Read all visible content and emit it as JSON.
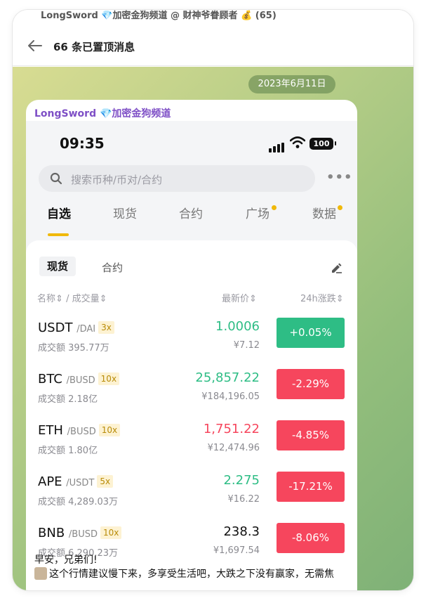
{
  "telegram": {
    "top_strip": "LongSword 💎加密金狗频道 @ 财神爷眷顾者 💰 (65)",
    "header_title": "66 条已置顶消息",
    "date_pill": "2023年6月11日",
    "sender": "LongSword 💎加密金狗频道",
    "message_line1": "早安，兄弟们!",
    "message_line2": "这个行情建议慢下来，多享受生活吧，大跌之下没有赢家，无需焦"
  },
  "phone": {
    "time": "09:35",
    "battery": "100"
  },
  "search": {
    "placeholder": "搜索币种/币对/合约"
  },
  "main_tabs": [
    {
      "label": "自选"
    },
    {
      "label": "现货"
    },
    {
      "label": "合约"
    },
    {
      "label": "广场"
    },
    {
      "label": "数据"
    }
  ],
  "sub_tabs": [
    {
      "label": "现货"
    },
    {
      "label": "合约"
    }
  ],
  "columns": {
    "name": "名称",
    "volume": "/ 成交量",
    "last_price": "最新价",
    "change": "24h涨跌"
  },
  "tickers": [
    {
      "base": "USDT",
      "quote": "/DAI",
      "leverage": "3x",
      "volume": "成交额 395.77万",
      "price": "1.0006",
      "fiat": "¥7.12",
      "change": "+0.05%",
      "price_color": "#2ebd85",
      "change_color": "#2ebd85"
    },
    {
      "base": "BTC",
      "quote": "/BUSD",
      "leverage": "10x",
      "volume": "成交额 2.18亿",
      "price": "25,857.22",
      "fiat": "¥184,196.05",
      "change": "-2.29%",
      "price_color": "#2ebd85",
      "change_color": "#f6465d"
    },
    {
      "base": "ETH",
      "quote": "/BUSD",
      "leverage": "10x",
      "volume": "成交额 1.80亿",
      "price": "1,751.22",
      "fiat": "¥12,474.96",
      "change": "-4.85%",
      "price_color": "#f6465d",
      "change_color": "#f6465d"
    },
    {
      "base": "APE",
      "quote": "/USDT",
      "leverage": "5x",
      "volume": "成交额 4,289.03万",
      "price": "2.275",
      "fiat": "¥16.22",
      "change": "-17.21%",
      "price_color": "#2ebd85",
      "change_color": "#f6465d"
    },
    {
      "base": "BNB",
      "quote": "/BUSD",
      "leverage": "10x",
      "volume": "成交额 6,290.23万",
      "price": "238.3",
      "fiat": "¥1,697.54",
      "change": "-8.06%",
      "price_color": "#111111",
      "change_color": "#f6465d"
    }
  ]
}
